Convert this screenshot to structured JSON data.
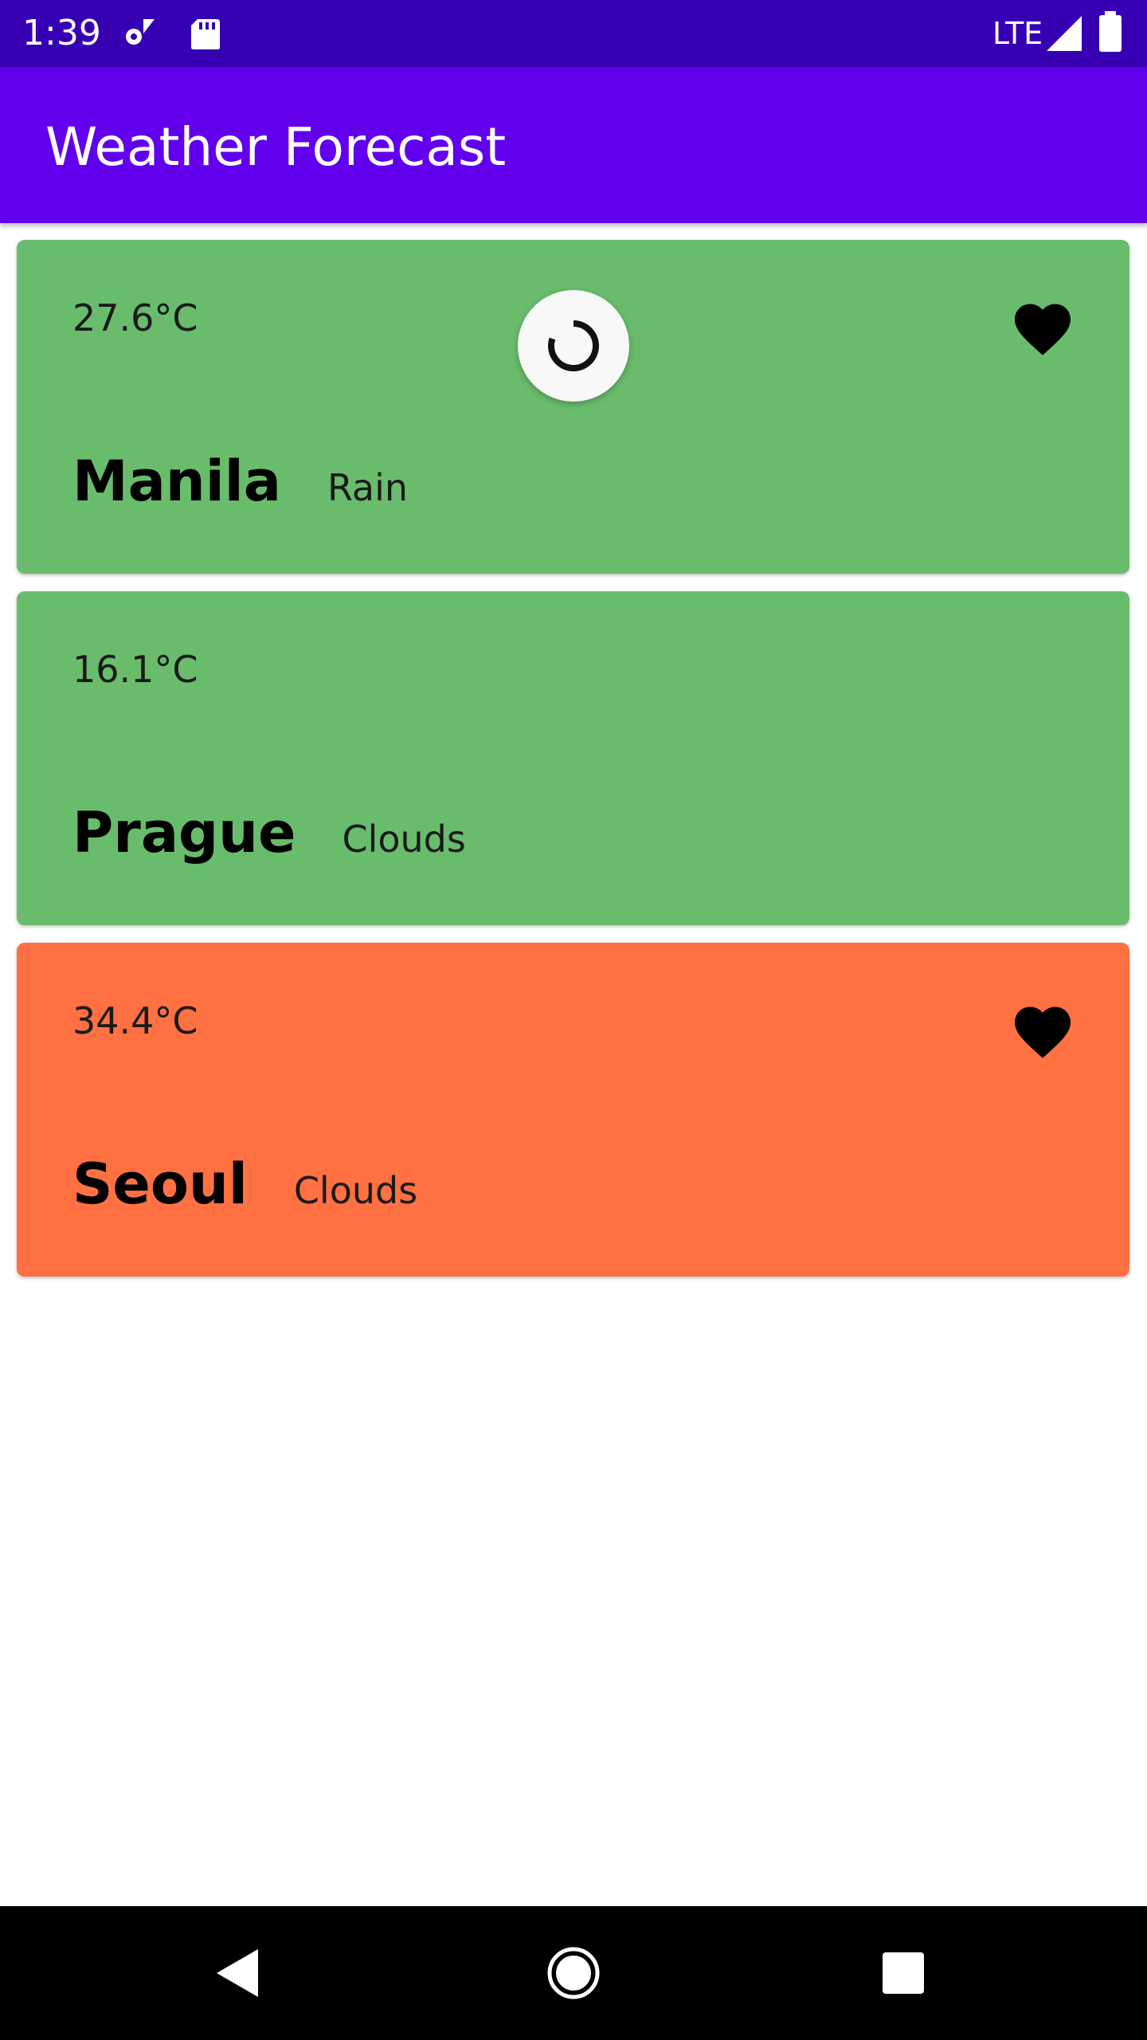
{
  "status_bar": {
    "time": "1:39",
    "network": "LTE",
    "background_color": "#3700b3",
    "icons": [
      "settings-icon",
      "sd-card-icon",
      "signal-icon",
      "battery-icon"
    ]
  },
  "app_bar": {
    "title": "Weather Forecast",
    "background_color": "#6200ee"
  },
  "loading_indicator": {
    "icon": "refresh-spinner-icon"
  },
  "cards": [
    {
      "temperature": "27.6°C",
      "city": "Manila",
      "condition": "Rain",
      "favorite": true,
      "background_color": "#69bc6c"
    },
    {
      "temperature": "16.1°C",
      "city": "Prague",
      "condition": "Clouds",
      "favorite": false,
      "background_color": "#69bc6c"
    },
    {
      "temperature": "34.4°C",
      "city": "Seoul",
      "condition": "Clouds",
      "favorite": true,
      "background_color": "#ff7043"
    }
  ],
  "nav_bar": {
    "buttons": [
      "back-icon",
      "home-icon",
      "recents-icon"
    ]
  }
}
